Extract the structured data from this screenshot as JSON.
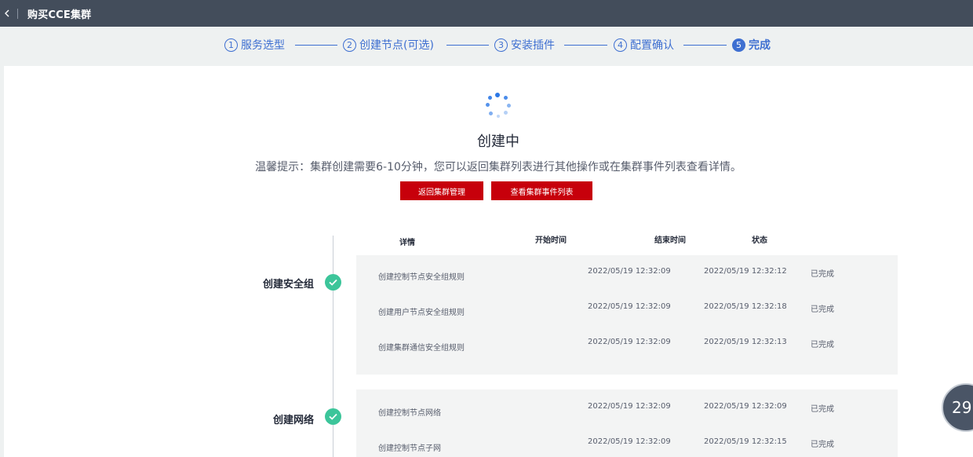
{
  "header": {
    "title": "购买CCE集群"
  },
  "steps": [
    {
      "num": "1",
      "label": "服务选型"
    },
    {
      "num": "2",
      "label": "创建节点(可选)"
    },
    {
      "num": "3",
      "label": "安装插件"
    },
    {
      "num": "4",
      "label": "配置确认"
    },
    {
      "num": "5",
      "label": "完成"
    }
  ],
  "status": {
    "title": "创建中",
    "hint": "温馨提示：集群创建需要6-10分钟，您可以返回集群列表进行其他操作或在集群事件列表查看详情。"
  },
  "buttons": {
    "back_to_cluster": "返回集群管理",
    "view_events": "查看集群事件列表"
  },
  "table": {
    "headers": [
      "详情",
      "开始时间",
      "结束时间",
      "状态"
    ],
    "groups": [
      {
        "label": "创建安全组",
        "rows": [
          {
            "detail": "创建控制节点安全组规则",
            "start": "2022/05/19 12:32:09",
            "end": "2022/05/19 12:32:12",
            "status": "已完成"
          },
          {
            "detail": "创建用户节点安全组规则",
            "start": "2022/05/19 12:32:09",
            "end": "2022/05/19 12:32:18",
            "status": "已完成"
          },
          {
            "detail": "创建集群通信安全组规则",
            "start": "2022/05/19 12:32:09",
            "end": "2022/05/19 12:32:13",
            "status": "已完成"
          }
        ]
      },
      {
        "label": "创建网络",
        "rows": [
          {
            "detail": "创建控制节点网络",
            "start": "2022/05/19 12:32:09",
            "end": "2022/05/19 12:32:09",
            "status": "已完成"
          },
          {
            "detail": "创建控制节点子网",
            "start": "2022/05/19 12:32:09",
            "end": "2022/05/19 12:32:15",
            "status": "已完成"
          }
        ]
      }
    ]
  },
  "timer": {
    "value": "29"
  },
  "colors": {
    "accent": "#3e6fd1",
    "primary_button": "#c7000b",
    "success": "#3cc59a",
    "topbar": "#434d5b"
  },
  "icons": {
    "back": "chevron-left-icon",
    "check": "check-circle-icon",
    "loading": "loading-spinner-icon"
  }
}
